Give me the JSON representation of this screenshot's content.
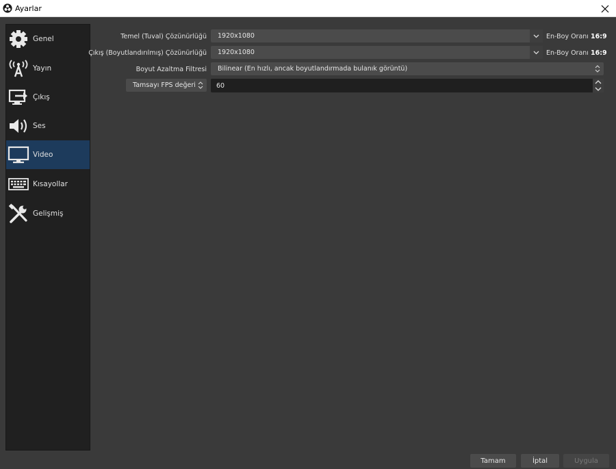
{
  "window": {
    "title": "Ayarlar",
    "app_icon": "obs-logo-icon",
    "close_icon": "close-icon"
  },
  "sidebar": {
    "items": [
      {
        "label": "Genel",
        "icon": "gear-icon"
      },
      {
        "label": "Yayın",
        "icon": "broadcast-antenna-icon"
      },
      {
        "label": "Çıkış",
        "icon": "output-monitor-icon"
      },
      {
        "label": "Ses",
        "icon": "speaker-icon"
      },
      {
        "label": "Video",
        "icon": "monitor-icon",
        "active": true
      },
      {
        "label": "Kısayollar",
        "icon": "keyboard-icon"
      },
      {
        "label": "Gelişmiş",
        "icon": "tools-icon"
      }
    ]
  },
  "video": {
    "base_resolution": {
      "label": "Temel (Tuval) Çözünürlüğü",
      "value": "1920x1080",
      "ratio_prefix": "En-Boy Oranı",
      "ratio_value": "16:9"
    },
    "output_resolution": {
      "label": "Çıkış (Boyutlandırılmış) Çözünürlüğü",
      "value": "1920x1080",
      "ratio_prefix": "En-Boy Oranı",
      "ratio_value": "16:9"
    },
    "downscale_filter": {
      "label": "Boyut Azaltma Filtresi",
      "value": "Bilinear (En hızlı, ancak boyutlandırmada bulanık görüntü)"
    },
    "fps": {
      "type_label": "Tamsayı FPS değeri",
      "value": "60"
    }
  },
  "buttons": {
    "ok": "Tamam",
    "cancel": "İptal",
    "apply": "Uygula"
  },
  "colors": {
    "window_bg": "#3a3a3a",
    "sidebar_bg": "#202020",
    "active_item_bg": "#1d3b5c",
    "field_bg": "#4b4b4b"
  }
}
